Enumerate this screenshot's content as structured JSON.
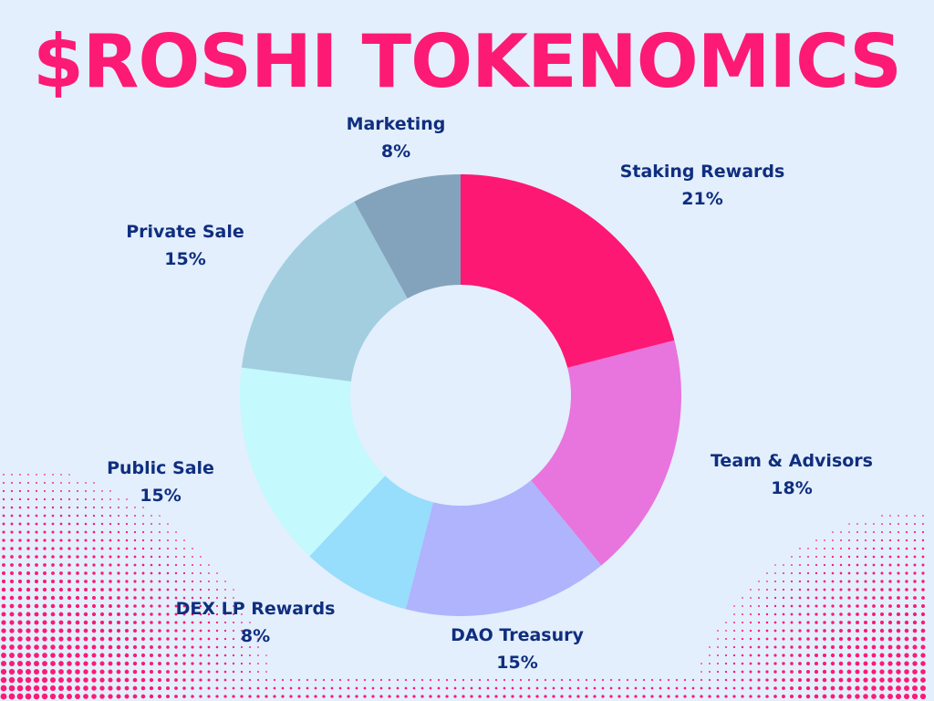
{
  "page": {
    "title": "$ROSHI TOKENOMICS",
    "background": "#e3effc",
    "title_color": "#fc1a74",
    "label_color": "#0f2e7f",
    "dot_color": "#fc1a74"
  },
  "chart_data": {
    "type": "pie",
    "donut": true,
    "title": "$ROSHI TOKENOMICS",
    "start_angle_deg": 0,
    "direction": "clockwise",
    "legend": "none",
    "slices": [
      {
        "label": "Staking Rewards",
        "value": 21,
        "display": "21%",
        "color": "#fd1873"
      },
      {
        "label": "Team & Advisors",
        "value": 18,
        "display": "18%",
        "color": "#e874de"
      },
      {
        "label": "DAO Treasury",
        "value": 15,
        "display": "15%",
        "color": "#afb4fd"
      },
      {
        "label": "DEX LP Rewards",
        "value": 8,
        "display": "8%",
        "color": "#97ddfc"
      },
      {
        "label": "Public Sale",
        "value": 15,
        "display": "15%",
        "color": "#c4f9fd"
      },
      {
        "label": "Private Sale",
        "value": 15,
        "display": "15%",
        "color": "#a3cee0"
      },
      {
        "label": "Marketing",
        "value": 8,
        "display": "8%",
        "color": "#83a3bc"
      }
    ]
  }
}
